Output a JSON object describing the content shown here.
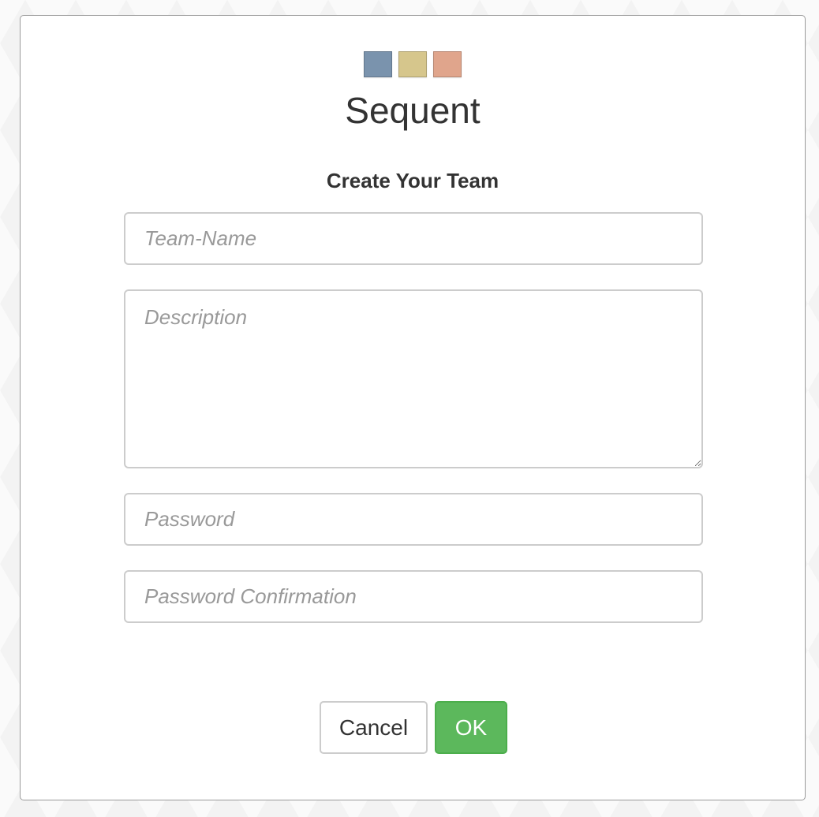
{
  "logo": {
    "colors": [
      "#7a93ad",
      "#d6c68c",
      "#e0a58c"
    ]
  },
  "app": {
    "title": "Sequent"
  },
  "form": {
    "heading": "Create Your Team",
    "team_name": {
      "value": "",
      "placeholder": "Team-Name"
    },
    "description": {
      "value": "",
      "placeholder": "Description"
    },
    "password": {
      "value": "",
      "placeholder": "Password"
    },
    "password_confirmation": {
      "value": "",
      "placeholder": "Password Confirmation"
    }
  },
  "actions": {
    "cancel_label": "Cancel",
    "ok_label": "OK",
    "ok_color": "#5cb85c"
  }
}
